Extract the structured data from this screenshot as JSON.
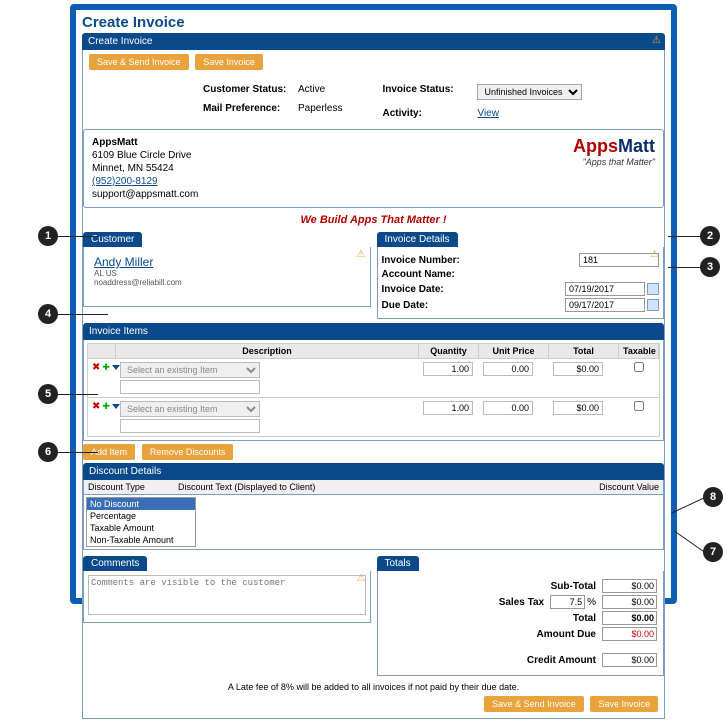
{
  "window_title": "Create Invoice",
  "panel_title": "Create Invoice",
  "top_buttons": {
    "save_send": "Save & Send Invoice",
    "save": "Save Invoice"
  },
  "meta": {
    "customer_status_label": "Customer Status:",
    "customer_status": "Active",
    "mail_pref_label": "Mail Preference:",
    "mail_pref": "Paperless",
    "invoice_status_label": "Invoice Status:",
    "invoice_status_value": "Unfinished Invoices",
    "activity_label": "Activity:",
    "activity_value": "View"
  },
  "company": {
    "name": "AppsMatt",
    "addr1": "6109 Blue Circle Drive",
    "addr2": "Minnet, MN 55424",
    "phone": "(952)200-8129",
    "email": "support@appsmatt.com",
    "tagline": "We Build Apps That Matter !",
    "logo_apps": "Apps",
    "logo_matt": "Matt",
    "logo_tag": "\"Apps that Matter\""
  },
  "customer": {
    "header": "Customer",
    "name": "Andy Miller",
    "locale": "AL US",
    "email": "noaddress@reliabill.com"
  },
  "invoice_details": {
    "header": "Invoice Details",
    "number_label": "Invoice Number:",
    "number_value": "181",
    "account_label": "Account Name:",
    "date_label": "Invoice Date:",
    "date_value": "07/19/2017",
    "due_label": "Due Date:",
    "due_value": "09/17/2017"
  },
  "items": {
    "header": "Invoice Items",
    "cols": {
      "desc": "Description",
      "qty": "Quantity",
      "price": "Unit Price",
      "total": "Total",
      "tax": "Taxable"
    },
    "placeholder": "Select an existing Item",
    "rows": [
      {
        "qty": "1.00",
        "price": "0.00",
        "total": "$0.00"
      },
      {
        "qty": "1.00",
        "price": "0.00",
        "total": "$0.00"
      }
    ],
    "add_btn": "Add Item",
    "remove_disc_btn": "Remove Discounts"
  },
  "discount": {
    "header": "Discount Details",
    "col_type": "Discount Type",
    "col_text": "Discount Text (Displayed to Client)",
    "col_value": "Discount Value",
    "options": [
      "No Discount",
      "Percentage",
      "Taxable Amount",
      "Non-Taxable Amount"
    ]
  },
  "comments": {
    "header": "Comments",
    "placeholder": "Comments are visible to the customer"
  },
  "totals": {
    "header": "Totals",
    "subtotal_label": "Sub-Total",
    "subtotal": "$0.00",
    "tax_label": "Sales Tax",
    "tax_rate": "7.5",
    "tax_pct": "%",
    "tax_amount": "$0.00",
    "total_label": "Total",
    "total": "$0.00",
    "due_label": "Amount Due",
    "due": "$0.00",
    "credit_label": "Credit Amount",
    "credit": "$0.00"
  },
  "late_fee": "A Late fee of 8% will be added to all invoices if not paid by their due date.",
  "bottom_buttons": {
    "save_send": "Save & Send Invoice",
    "save": "Save Invoice"
  },
  "callouts": [
    "1",
    "2",
    "3",
    "4",
    "5",
    "6",
    "7",
    "8"
  ]
}
